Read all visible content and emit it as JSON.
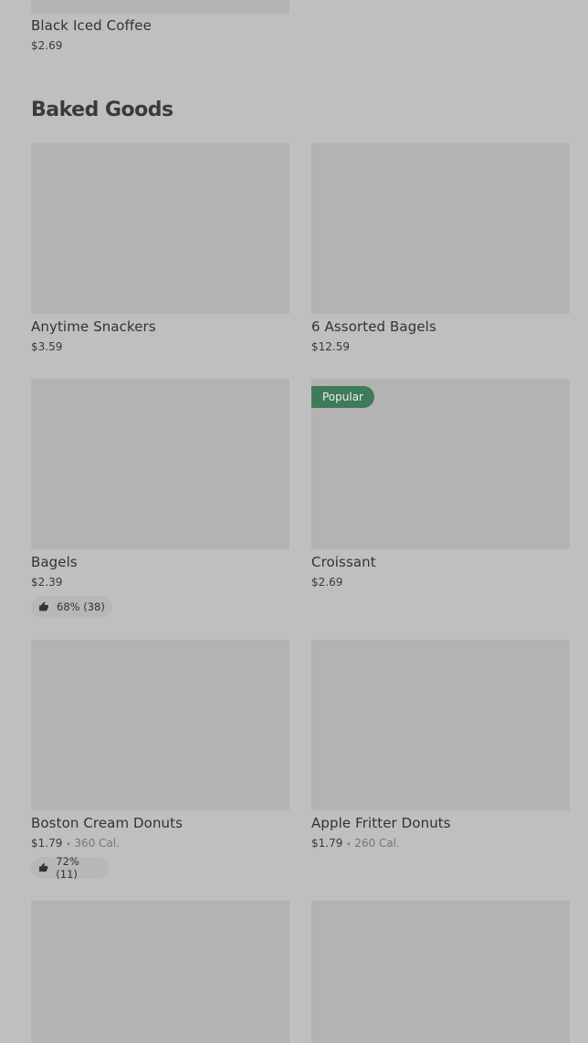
{
  "top_item": {
    "name": "Black Iced Coffee",
    "price": "$2.69"
  },
  "section": {
    "title": "Baked Goods"
  },
  "items": [
    {
      "name": "Anytime Snackers",
      "price": "$3.59"
    },
    {
      "name": "6 Assorted Bagels",
      "price": "$12.59"
    },
    {
      "name": "Bagels",
      "price": "$2.39",
      "rating": "68% (38)"
    },
    {
      "name": "Croissant",
      "price": "$2.69",
      "badge": "Popular"
    },
    {
      "name": "Boston Cream Donuts",
      "price": "$1.79",
      "separator": "•",
      "calories": "360 Cal.",
      "rating": "72% (11)"
    },
    {
      "name": "Apple Fritter Donuts",
      "price": "$1.79",
      "separator": "•",
      "calories": "260 Cal."
    }
  ],
  "icons": {
    "rating": "thumbs-up-icon"
  }
}
